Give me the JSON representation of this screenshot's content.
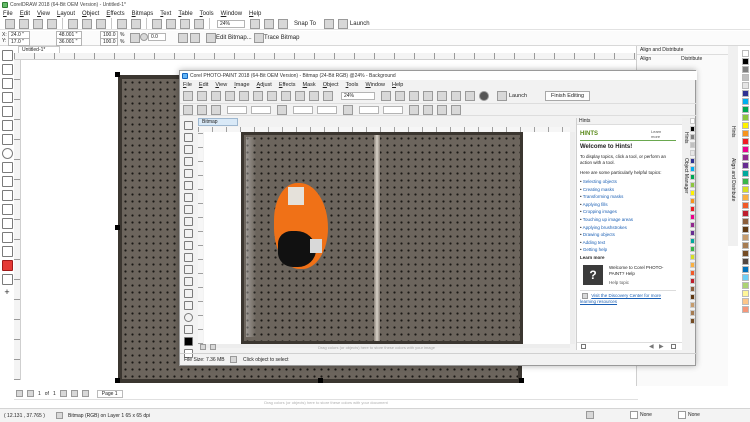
{
  "outer": {
    "title": "CorelDRAW 2018 (64-Bit OEM Version) - Untitled-1*",
    "menu": [
      "File",
      "Edit",
      "View",
      "Layout",
      "Object",
      "Effects",
      "Bitmaps",
      "Text",
      "Table",
      "Tools",
      "Window",
      "Help"
    ],
    "toolbar": {
      "zoom": "24%",
      "snap_to": "Snap To",
      "launch": "Launch"
    },
    "propbar": {
      "x": "24.0 \"",
      "y": "17.0 \"",
      "w": "48.001 \"",
      "h": "36.001 \"",
      "scale_w": "100.0",
      "scale_h": "100.0",
      "pct": "%",
      "angle": "0.0",
      "edit_bitmap": "Edit Bitmap...",
      "trace_bitmap": "Trace Bitmap"
    },
    "doc_tab": "Untitled-1*",
    "page_nav": {
      "current": "1",
      "of": "of",
      "total": "1",
      "page_tab": "Page 1"
    },
    "palette_hint": "Drag colors (or objects) here to store these colors with your document",
    "status": {
      "coords": "( 12.131 , 37.765 )",
      "object_info": "Bitmap (RGB) on Layer 1 65 x 65 dpi",
      "fill": "None",
      "outline": "None"
    },
    "docker": {
      "title": "Align and Distribute",
      "align": "Align",
      "distribute": "Distribute",
      "vtabs": [
        "Hints",
        "Align and Distribute"
      ]
    },
    "colors": [
      "#ffffff",
      "#000000",
      "#7f7f7f",
      "#c0c0c0",
      "#e6e6e6",
      "#2e3192",
      "#00aeef",
      "#00a651",
      "#8dc63f",
      "#fff200",
      "#f7941d",
      "#ed1c24",
      "#ec008c",
      "#92278f",
      "#662d91",
      "#00a99d",
      "#39b54a",
      "#d7df23",
      "#fbb040",
      "#f15a29",
      "#be1e2d",
      "#8b5e3c",
      "#603913",
      "#c69c6d",
      "#a67c52",
      "#754c24",
      "#534741",
      "#0072bc",
      "#6dcff6",
      "#acd373",
      "#fff799",
      "#fdc689",
      "#f69679"
    ]
  },
  "inner": {
    "title": "Corel PHOTO-PAINT 2018 (64-Bit OEM Version) - Bitmap (24-Bit RGB) @24% - Background",
    "menu": [
      "File",
      "Edit",
      "View",
      "Image",
      "Adjust",
      "Effects",
      "Mask",
      "Object",
      "Tools",
      "Window",
      "Help"
    ],
    "toolbar": {
      "zoom": "24%",
      "launch": "Launch",
      "finish": "Finish Editing"
    },
    "doc_tab": "Bitmap",
    "status_left": "File Size: 7.36 MB",
    "status_right": "Click object to select",
    "palette_hint": "Drag colors (or objects) here to store these colors with your image",
    "docker_tab": "Hints",
    "vtabs": [
      "Hints",
      "Object Manager"
    ]
  },
  "hints": {
    "header": "HINTS",
    "learn_more_top": "Learn more",
    "welcome": "Welcome to Hints!",
    "intro": "To display topics, click a tool, or perform an action with a tool.",
    "topics_lead": "Here are some particularly helpful topics:",
    "topics": [
      "Selecting objects",
      "Creating masks",
      "Transforming masks",
      "Applying fills",
      "Cropping images",
      "Touching up image areas",
      "Applying brushstrokes",
      "Drawing objects",
      "Adding text",
      "Getting help"
    ],
    "learn_more": "Learn more",
    "card_title": "Welcome to Corel PHOTO-PAINT? Help",
    "card_sub": "Help topic",
    "discovery": "Visit the Discovery Center for more learning resources"
  }
}
